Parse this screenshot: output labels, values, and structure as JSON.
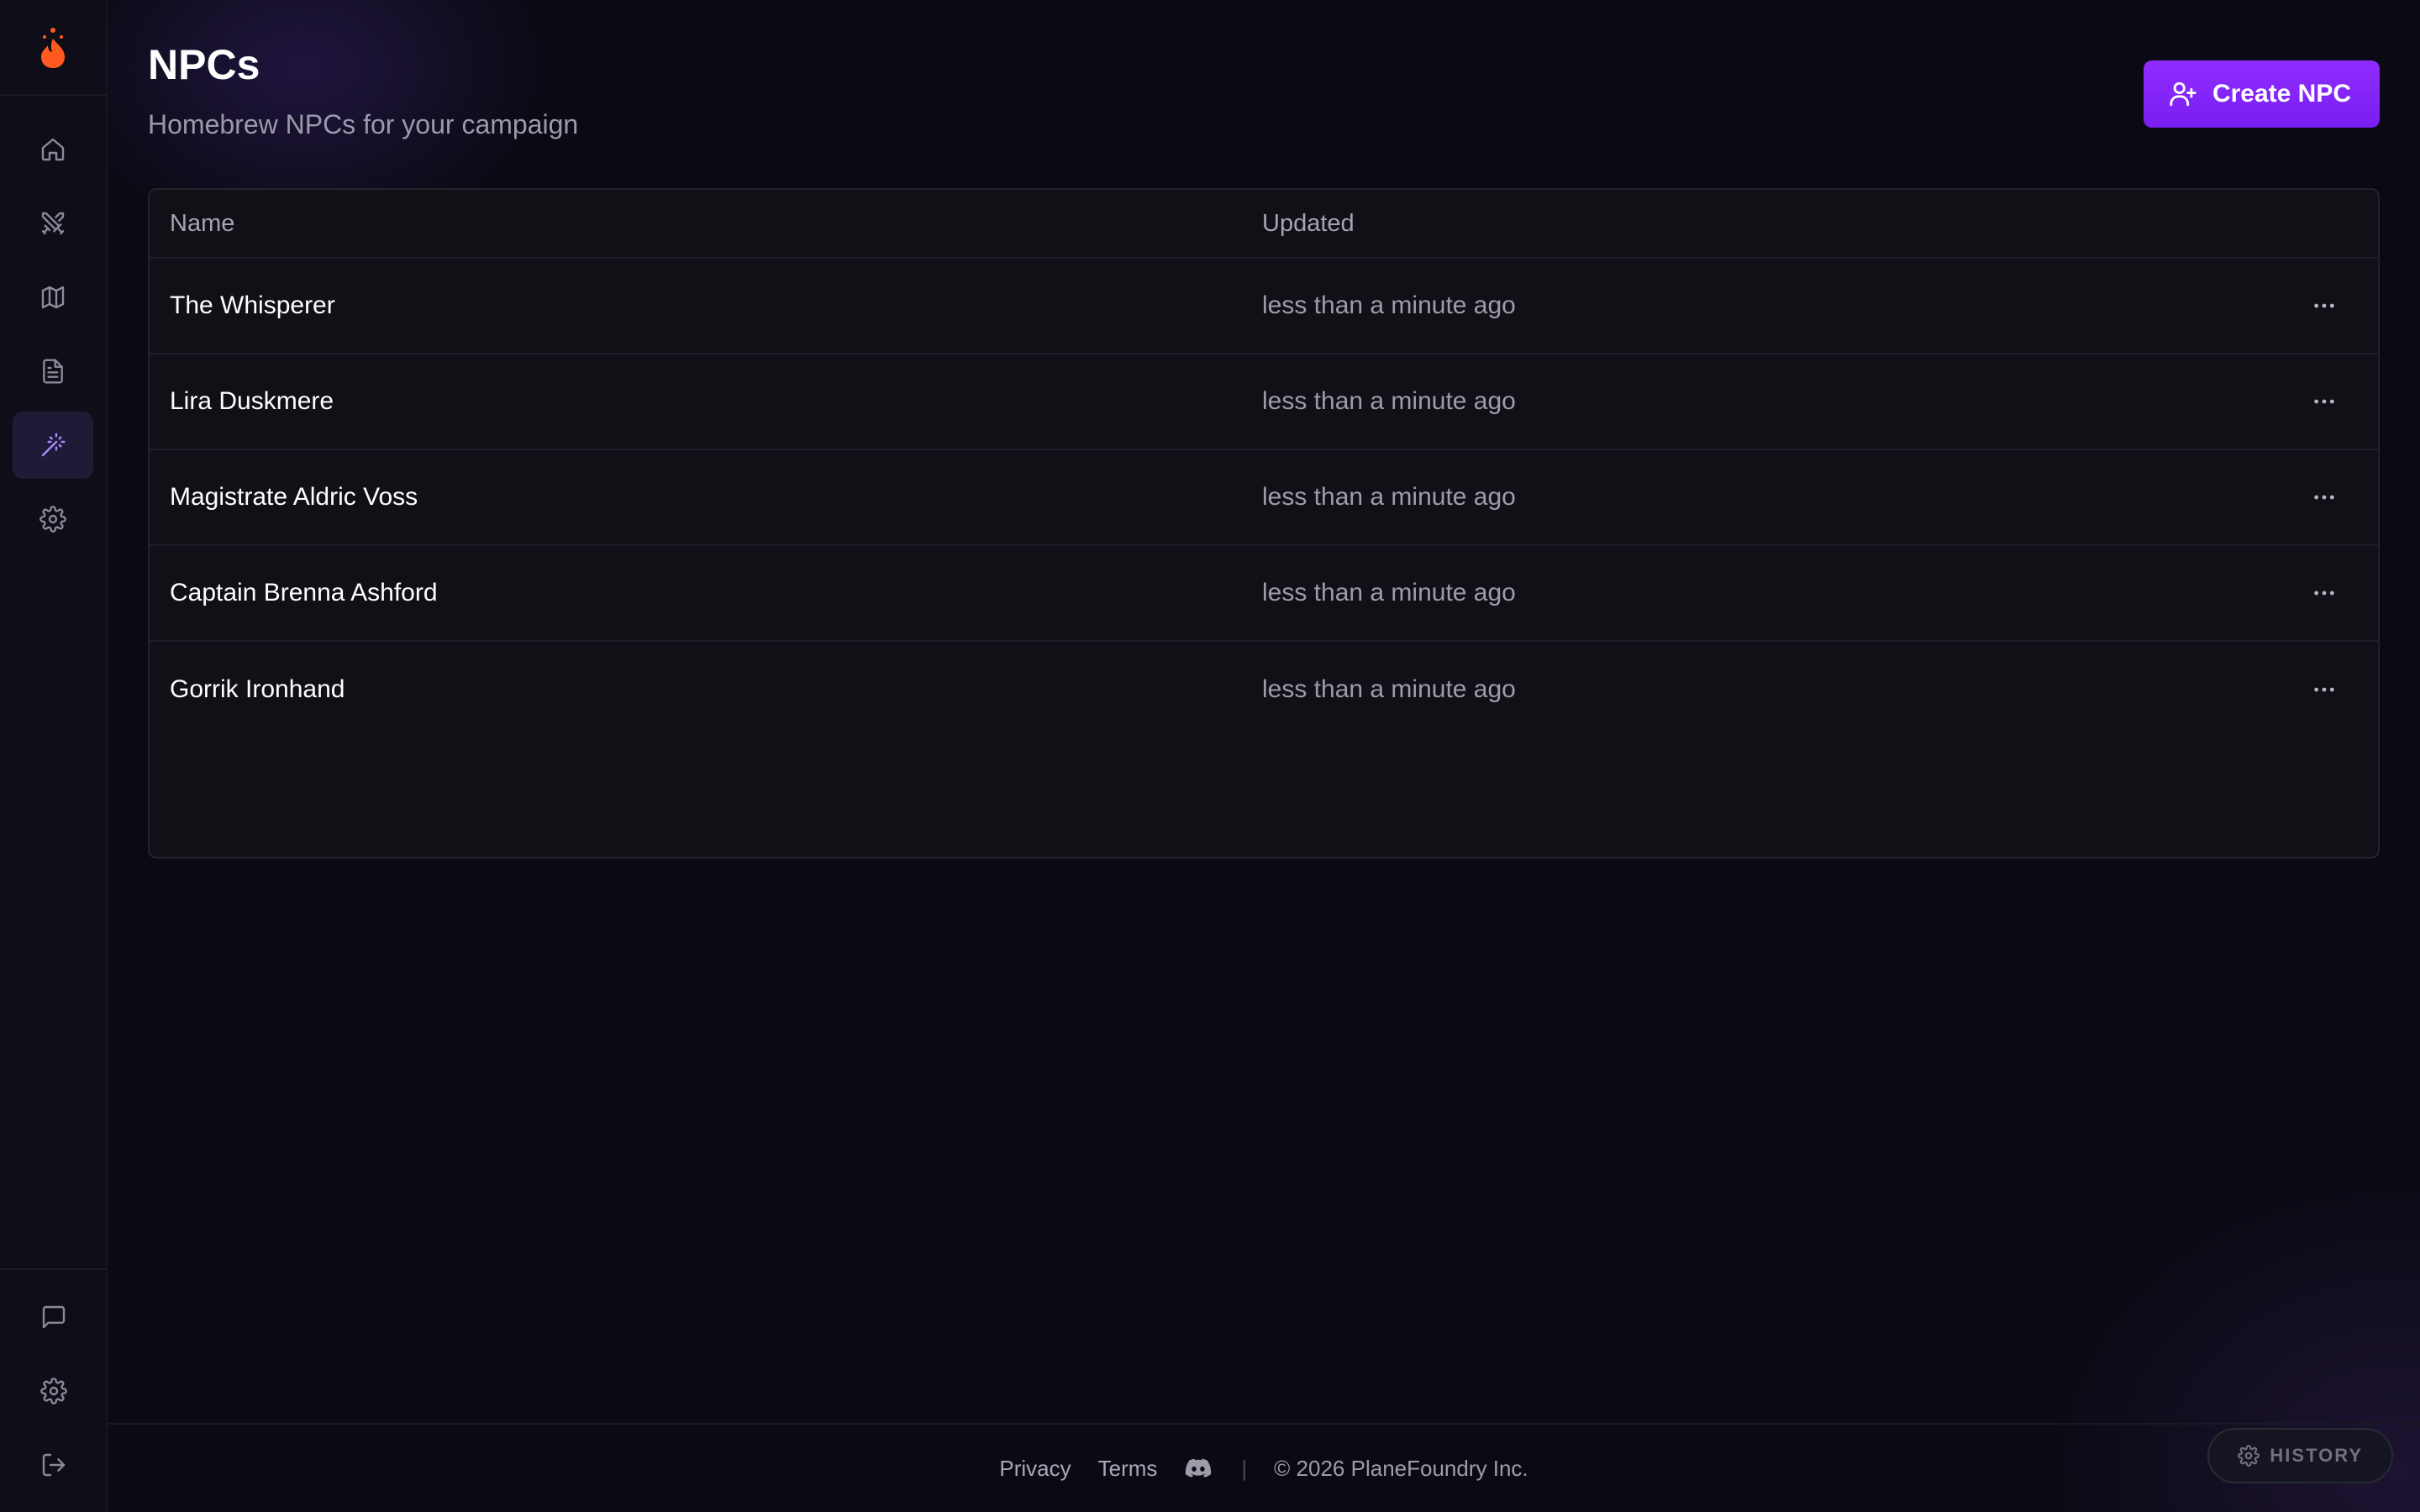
{
  "header": {
    "title": "NPCs",
    "subtitle": "Homebrew NPCs for your campaign",
    "create_label": "Create NPC"
  },
  "table": {
    "columns": [
      "Name",
      "Updated"
    ],
    "rows": [
      {
        "name": "The Whisperer",
        "updated": "less than a minute ago"
      },
      {
        "name": "Lira Duskmere",
        "updated": "less than a minute ago"
      },
      {
        "name": "Magistrate Aldric Voss",
        "updated": "less than a minute ago"
      },
      {
        "name": "Captain Brenna Ashford",
        "updated": "less than a minute ago"
      },
      {
        "name": "Gorrik Ironhand",
        "updated": "less than a minute ago"
      }
    ]
  },
  "sidebar": {
    "items": [
      {
        "icon": "home-icon",
        "active": false
      },
      {
        "icon": "crossed-swords-icon",
        "active": false
      },
      {
        "icon": "map-icon",
        "active": false
      },
      {
        "icon": "document-icon",
        "active": false
      },
      {
        "icon": "magic-wand-icon",
        "active": true
      },
      {
        "icon": "gear-icon",
        "active": false
      }
    ],
    "bottom_items": [
      {
        "icon": "chat-icon"
      },
      {
        "icon": "gear-icon"
      },
      {
        "icon": "logout-icon"
      }
    ]
  },
  "footer": {
    "privacy": "Privacy",
    "terms": "Terms",
    "separator": "|",
    "copyright": "© 2026 PlaneFoundry Inc."
  },
  "history_label": "HISTORY",
  "colors": {
    "accent": "#8f2cff",
    "logo": "#ff5a1f",
    "background": "#0b0a14"
  }
}
